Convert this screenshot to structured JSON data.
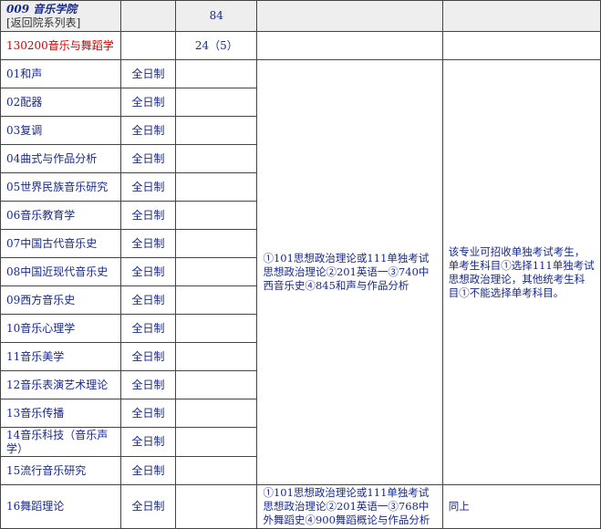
{
  "department": {
    "code_name": "009 音乐学院",
    "back_link": "[返回院系列表]",
    "quota": "84"
  },
  "major": {
    "name": "130200音乐与舞蹈学",
    "quota": "24（5）"
  },
  "directions": [
    {
      "name": "01和声",
      "mode": "全日制"
    },
    {
      "name": "02配器",
      "mode": "全日制"
    },
    {
      "name": "03复调",
      "mode": "全日制"
    },
    {
      "name": "04曲式与作品分析",
      "mode": "全日制"
    },
    {
      "name": "05世界民族音乐研究",
      "mode": "全日制"
    },
    {
      "name": "06音乐教育学",
      "mode": "全日制"
    },
    {
      "name": "07中国古代音乐史",
      "mode": "全日制"
    },
    {
      "name": "08中国近现代音乐史",
      "mode": "全日制"
    },
    {
      "name": "09西方音乐史",
      "mode": "全日制"
    },
    {
      "name": "10音乐心理学",
      "mode": "全日制"
    },
    {
      "name": "11音乐美学",
      "mode": "全日制"
    },
    {
      "name": "12音乐表演艺术理论",
      "mode": "全日制"
    },
    {
      "name": "13音乐传播",
      "mode": "全日制"
    },
    {
      "name": "14音乐科技（音乐声学）",
      "mode": "全日制"
    },
    {
      "name": "15流行音乐研究",
      "mode": "全日制"
    },
    {
      "name": "16舞蹈理论",
      "mode": "全日制"
    }
  ],
  "exam_subjects_1": "①101思想政治理论或111单独考试思想政治理论②201英语一③740中西音乐史④845和声与作品分析",
  "note_1": "该专业可招收单独考试考生，单考生科目①选择111单独考试思想政治理论，其他统考生科目①不能选择单考科目。",
  "exam_subjects_2": "①101思想政治理论或111单独考试思想政治理论②201英语一③768中外舞蹈史④900舞蹈概论与作品分析",
  "note_2": "同上"
}
